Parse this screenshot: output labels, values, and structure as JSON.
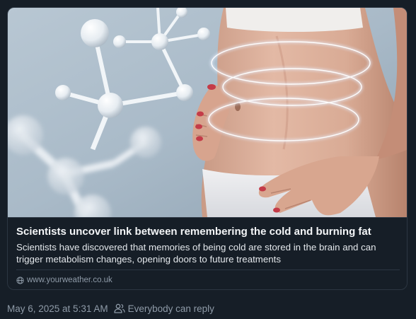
{
  "link_card": {
    "title": "Scientists uncover link between remembering the cold and burning fat",
    "description": "Scientists have discovered that memories of being cold are stored in the brain and can trigger metabolism changes, opening doors to future treatments",
    "domain": "www.yourweather.co.uk",
    "domain_icon": "globe-icon",
    "image": "molecule model beside woman's waist with glowing rings"
  },
  "post_footer": {
    "timestamp": "May 6, 2025 at 5:31 AM",
    "reply_setting": "Everybody can reply",
    "reply_icon": "people-icon"
  },
  "colors": {
    "background": "#161e27",
    "border": "#2c3642",
    "title": "#f3f5f7",
    "muted": "#8e9aa7"
  }
}
